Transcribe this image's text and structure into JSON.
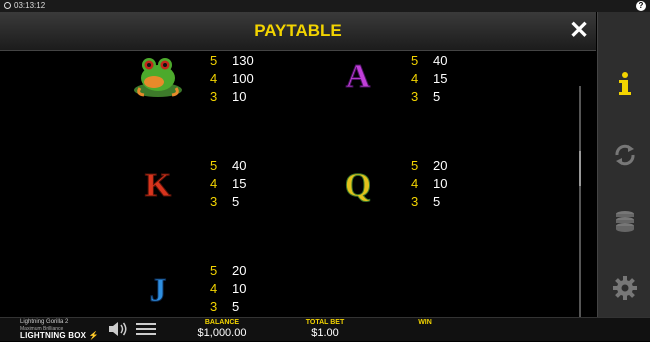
{
  "status": {
    "time": "03:13:12"
  },
  "header": {
    "title": "PAYTABLE"
  },
  "paytable": [
    {
      "symbol": "frog",
      "pays": [
        {
          "count": "5",
          "amount": "130"
        },
        {
          "count": "4",
          "amount": "100"
        },
        {
          "count": "3",
          "amount": "10"
        }
      ]
    },
    {
      "symbol": "A",
      "color": "#c13fd9",
      "pays": [
        {
          "count": "5",
          "amount": "40"
        },
        {
          "count": "4",
          "amount": "15"
        },
        {
          "count": "3",
          "amount": "5"
        }
      ]
    },
    {
      "symbol": "K",
      "color": "#d8341d",
      "pays": [
        {
          "count": "5",
          "amount": "40"
        },
        {
          "count": "4",
          "amount": "15"
        },
        {
          "count": "3",
          "amount": "5"
        }
      ]
    },
    {
      "symbol": "Q",
      "color": "#e3c21b",
      "pays": [
        {
          "count": "5",
          "amount": "20"
        },
        {
          "count": "4",
          "amount": "10"
        },
        {
          "count": "3",
          "amount": "5"
        }
      ]
    },
    {
      "symbol": "J",
      "color": "#2f8fe0",
      "pays": [
        {
          "count": "5",
          "amount": "20"
        },
        {
          "count": "4",
          "amount": "10"
        },
        {
          "count": "3",
          "amount": "5"
        }
      ]
    }
  ],
  "sidebar": {
    "icons": [
      "info-icon",
      "autoplay-icon",
      "bet-coins-icon",
      "settings-gear-icon"
    ],
    "active_color": "#f3d400"
  },
  "footer": {
    "game_name": "Lightning Gorilla 2",
    "game_subtitle": "Maximum Brilliance",
    "brand_name": "LIGHTNING BOX",
    "balance_label": "BALANCE",
    "balance_value": "$1,000.00",
    "bet_label": "TOTAL BET",
    "bet_value": "$1.00",
    "win_label": "WIN",
    "win_value": ""
  },
  "colors": {
    "accent": "#f3d400",
    "background": "#000000",
    "sidebar": "#2e2e2e"
  }
}
